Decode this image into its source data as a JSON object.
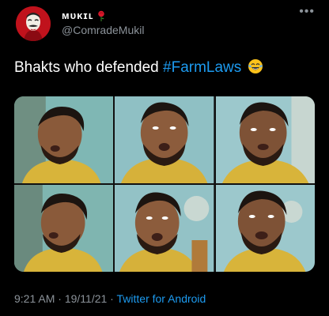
{
  "user": {
    "display_name": "ᴍᴜᴋɪʟ",
    "handle": "@ComradeMukil"
  },
  "tweet": {
    "text_before": "Bhakts who defended ",
    "hashtag": "#FarmLaws",
    "emoji": "face-with-tears-of-joy-icon"
  },
  "media": {
    "frame_count": 6
  },
  "footer": {
    "time": "9:21 AM",
    "separator": " · ",
    "date": "19/11/21",
    "separator2": " · ",
    "source": "Twitter for Android"
  },
  "colors": {
    "background": "#000000",
    "link": "#1d9bf0",
    "secondary_text": "#8b9299",
    "primary_text": "#ffffff"
  }
}
